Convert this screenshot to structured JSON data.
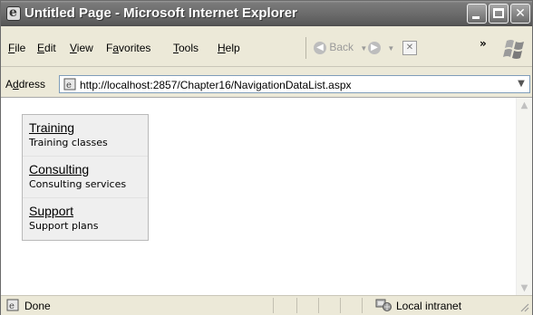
{
  "window": {
    "title": "Untitled Page - Microsoft Internet Explorer",
    "controls": {
      "minimize": "",
      "maximize": "",
      "close": "✕"
    }
  },
  "menu": {
    "items": [
      {
        "label": "File",
        "accel": "F",
        "rest": "ile"
      },
      {
        "label": "Edit",
        "accel": "E",
        "rest": "dit"
      },
      {
        "label": "View",
        "accel": "V",
        "rest": "iew"
      },
      {
        "label": "Favorites",
        "accel": "a",
        "pre": "F",
        "rest": "vorites"
      },
      {
        "label": "Tools",
        "accel": "T",
        "rest": "ools"
      },
      {
        "label": "Help",
        "accel": "H",
        "rest": "elp"
      }
    ],
    "back_label": "Back",
    "more": "»"
  },
  "address": {
    "label": "Address",
    "url": "http://localhost:2857/Chapter16/NavigationDataList.aspx"
  },
  "datalist": {
    "items": [
      {
        "title": "Training",
        "description": "Training classes"
      },
      {
        "title": "Consulting",
        "description": "Consulting services"
      },
      {
        "title": "Support",
        "description": "Support plans"
      }
    ]
  },
  "status": {
    "text": "Done",
    "zone": "Local intranet"
  }
}
